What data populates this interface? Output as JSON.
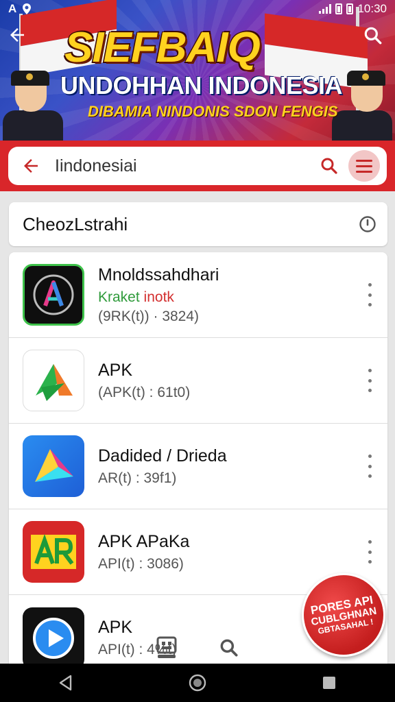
{
  "status_bar": {
    "left_icons": [
      "a-icon",
      "location-icon"
    ],
    "time": "10:30"
  },
  "banner": {
    "title": "SIEFBAIQ",
    "subtitle": "UNDOHHAN INDONESIA",
    "tagline": "DIBAMIA NINDONIS SDON FENGIS"
  },
  "search": {
    "query": "Iindonesiai"
  },
  "section": {
    "title": "CheozLstrahi"
  },
  "apps": [
    {
      "title": "Mnoldssahdhari",
      "sub_green": "Kraket",
      "sub_red": "inotk",
      "meta": "(9RK(t)) · 3824)"
    },
    {
      "title": "APK",
      "meta": "(APK(t) : 61t0)"
    },
    {
      "title": "Dadided / Drieda",
      "meta": "AR(t) : 39f1)"
    },
    {
      "title": "APK APaKa",
      "meta": "API(t) : 3086)"
    },
    {
      "title": "APK",
      "meta": "API(t) : 4%t)"
    }
  ],
  "badge": {
    "line1": "PORES API",
    "line2": "CUBLGHNAN",
    "line3": "GBTASAHAL !"
  },
  "colors": {
    "accent_red": "#d9262a",
    "green": "#2e9a3a"
  }
}
